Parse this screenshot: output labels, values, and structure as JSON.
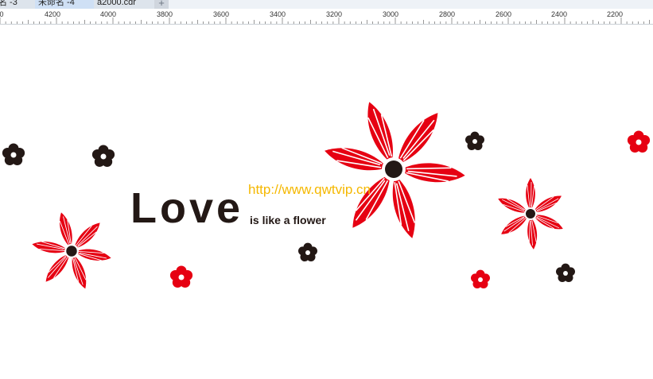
{
  "tabs": [
    {
      "label": "名 -3"
    },
    {
      "label": "未命名 -4"
    },
    {
      "label": "a2000.cdr"
    }
  ],
  "tab_add_label": "+",
  "ruler": {
    "labels": [
      "0",
      "4200",
      "4000",
      "3800",
      "3600",
      "3400",
      "3200",
      "3000",
      "2800",
      "2600",
      "2400",
      "2200"
    ]
  },
  "artwork": {
    "title": "Love",
    "subtitle": "is like a flower",
    "watermark": "http://www.qwtvip.cn"
  },
  "colors": {
    "flower_red": "#e60012",
    "flower_black": "#231815",
    "watermark": "#f5b800"
  },
  "icons": {
    "add_tab": "plus-icon",
    "flower": "flower-icon"
  }
}
